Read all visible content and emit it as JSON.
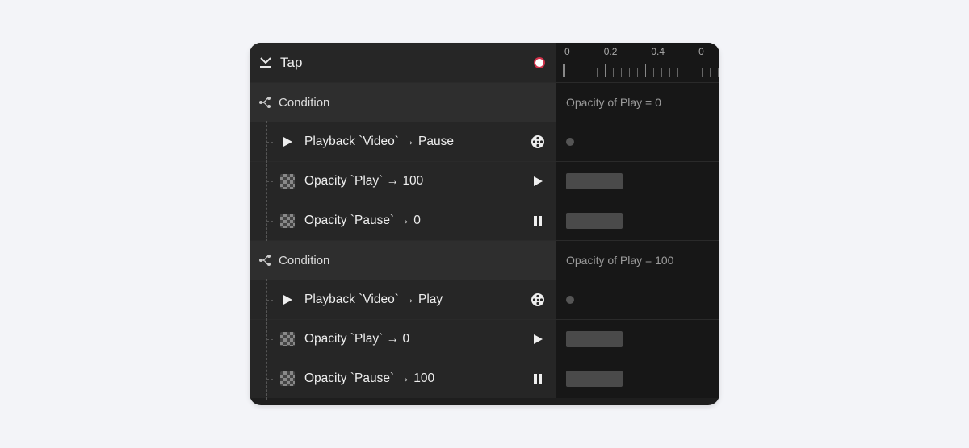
{
  "header": {
    "title": "Tap",
    "ruler": [
      "0",
      "0.2",
      "0.4",
      "0"
    ]
  },
  "conditions": [
    {
      "label": "Condition",
      "description": "Opacity of Play = 0",
      "actions": [
        {
          "icon": "play",
          "text": "Playback `Video` → Pause",
          "target": "reel",
          "timeline": "dot"
        },
        {
          "icon": "checker",
          "text": "Opacity `Play` → 100",
          "target": "play",
          "timeline": "bar"
        },
        {
          "icon": "checker",
          "text": "Opacity `Pause` → 0",
          "target": "pause",
          "timeline": "bar"
        }
      ]
    },
    {
      "label": "Condition",
      "description": "Opacity of Play = 100",
      "actions": [
        {
          "icon": "play",
          "text": "Playback `Video` → Play",
          "target": "reel",
          "timeline": "dot"
        },
        {
          "icon": "checker",
          "text": "Opacity `Play` → 0",
          "target": "play",
          "timeline": "bar"
        },
        {
          "icon": "checker",
          "text": "Opacity `Pause` → 100",
          "target": "pause",
          "timeline": "bar"
        }
      ]
    }
  ]
}
